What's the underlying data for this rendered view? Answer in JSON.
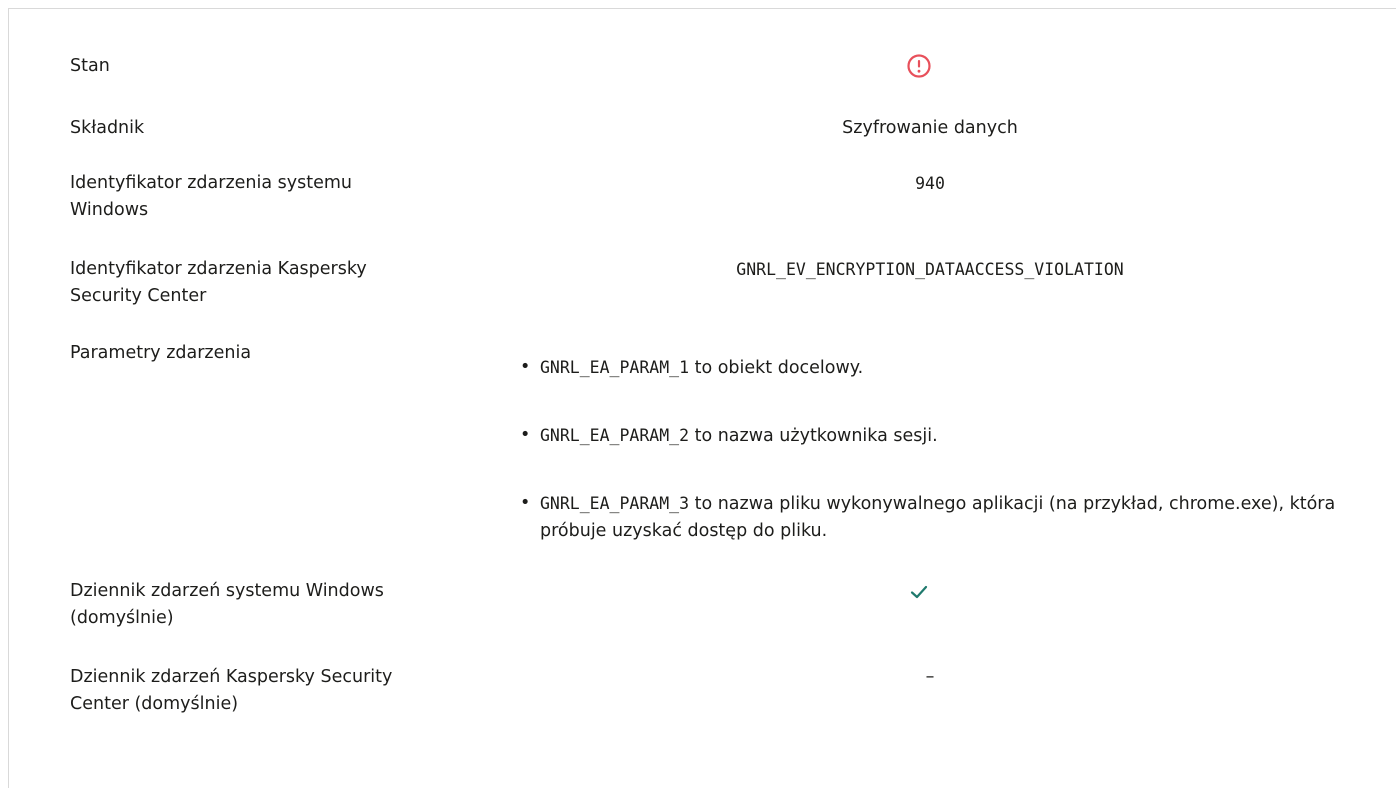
{
  "rows": {
    "status": {
      "label": "Stan",
      "icon": "error-circle-icon",
      "icon_color": "#e8505b"
    },
    "component": {
      "label": "Składnik",
      "value": "Szyfrowanie danych"
    },
    "windows_event_id": {
      "label": "Identyfikator zdarzenia systemu Windows",
      "value": "940"
    },
    "ksc_event_id": {
      "label": "Identyfikator zdarzenia Kaspersky Security Center",
      "value": "GNRL_EV_ENCRYPTION_DATAACCESS_VIOLATION"
    },
    "event_params": {
      "label": "Parametry zdarzenia",
      "items": [
        {
          "code": "GNRL_EA_PARAM_1",
          "text": " to obiekt docelowy."
        },
        {
          "code": "GNRL_EA_PARAM_2",
          "text": " to nazwa użytkownika sesji."
        },
        {
          "code": "GNRL_EA_PARAM_3",
          "text": " to nazwa pliku wykonywalnego aplikacji (na przykład, chrome.exe), która próbuje uzyskać dostęp do pliku."
        }
      ]
    },
    "windows_log": {
      "label": "Dziennik zdarzeń systemu Windows (domyślnie)",
      "icon": "checkmark-icon",
      "icon_color": "#1f7a6d"
    },
    "ksc_log": {
      "label": "Dziennik zdarzeń Kaspersky Security Center (domyślnie)",
      "value": "–"
    }
  }
}
